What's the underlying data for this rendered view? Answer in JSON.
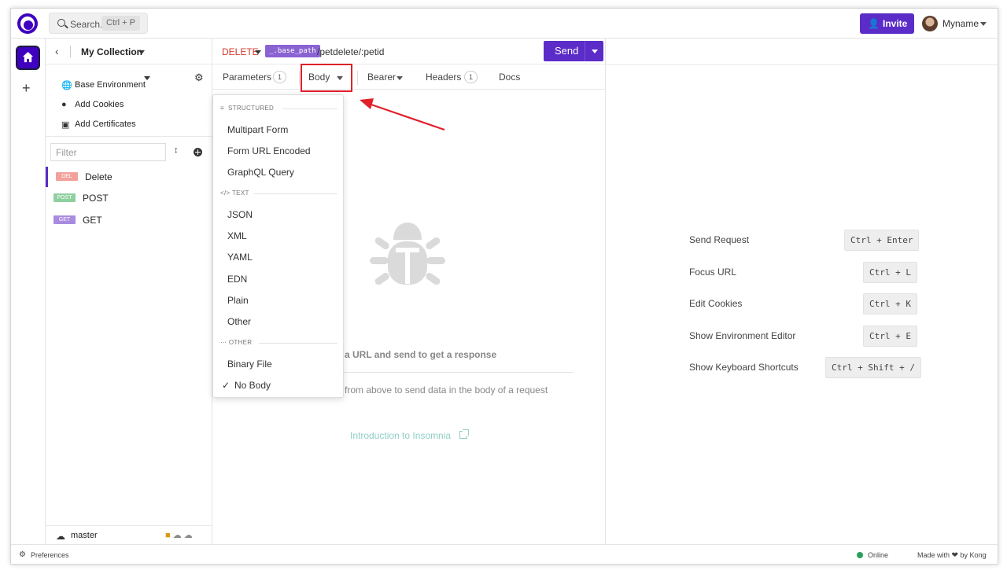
{
  "topbar": {
    "search_label": "Search..",
    "search_shortcut": "Ctrl + P",
    "invite_label": "Invite",
    "username": "Myname"
  },
  "sidebar": {
    "collection_name": "My Collection",
    "environment_label": "Base Environment",
    "add_cookies": "Add Cookies",
    "add_certificates": "Add Certificates",
    "filter_placeholder": "Filter",
    "requests": [
      {
        "badge": "DEL",
        "name": "Delete",
        "badge_color": "#f3a09b",
        "active": true
      },
      {
        "badge": "POST",
        "name": "POST",
        "badge_color": "#8fd0a0",
        "active": false
      },
      {
        "badge": "GET",
        "name": "GET",
        "badge_color": "#a98be0",
        "active": false
      }
    ],
    "branch": "master"
  },
  "request": {
    "method": "DELETE",
    "url_variable": "_.base_path",
    "url_path": "/petdelete/:petid",
    "send_label": "Send",
    "tabs": {
      "parameters": "Parameters",
      "parameters_count": "1",
      "body": "Body",
      "auth": "Bearer",
      "headers": "Headers",
      "headers_count": "1",
      "docs": "Docs"
    },
    "empty_title": "r a URL and send to get a response",
    "empty_subtitle": "from above to send data in the body of a request",
    "intro_link": "Introduction to Insomnia"
  },
  "body_dropdown": {
    "structured_header": "STRUCTURED",
    "structured_items": [
      "Multipart Form",
      "Form URL Encoded",
      "GraphQL Query"
    ],
    "text_header": "TEXT",
    "text_items": [
      "JSON",
      "XML",
      "YAML",
      "EDN",
      "Plain",
      "Other"
    ],
    "other_header": "OTHER",
    "other_items": [
      "Binary File",
      "No Body"
    ],
    "selected": "No Body"
  },
  "shortcuts": [
    {
      "label": "Send Request",
      "keys": "Ctrl + Enter"
    },
    {
      "label": "Focus URL",
      "keys": "Ctrl + L"
    },
    {
      "label": "Edit Cookies",
      "keys": "Ctrl + K"
    },
    {
      "label": "Show Environment Editor",
      "keys": "Ctrl + E"
    },
    {
      "label": "Show Keyboard Shortcuts",
      "keys": "Ctrl + Shift + /"
    }
  ],
  "statusbar": {
    "preferences": "Preferences",
    "status": "Online",
    "made_with": "Made with",
    "by": "by Kong"
  },
  "colors": {
    "accent": "#5b2cc8",
    "brand": "#4000bf",
    "method_delete": "#d0392b",
    "highlight": "#e0202a",
    "online": "#2aa05a"
  }
}
